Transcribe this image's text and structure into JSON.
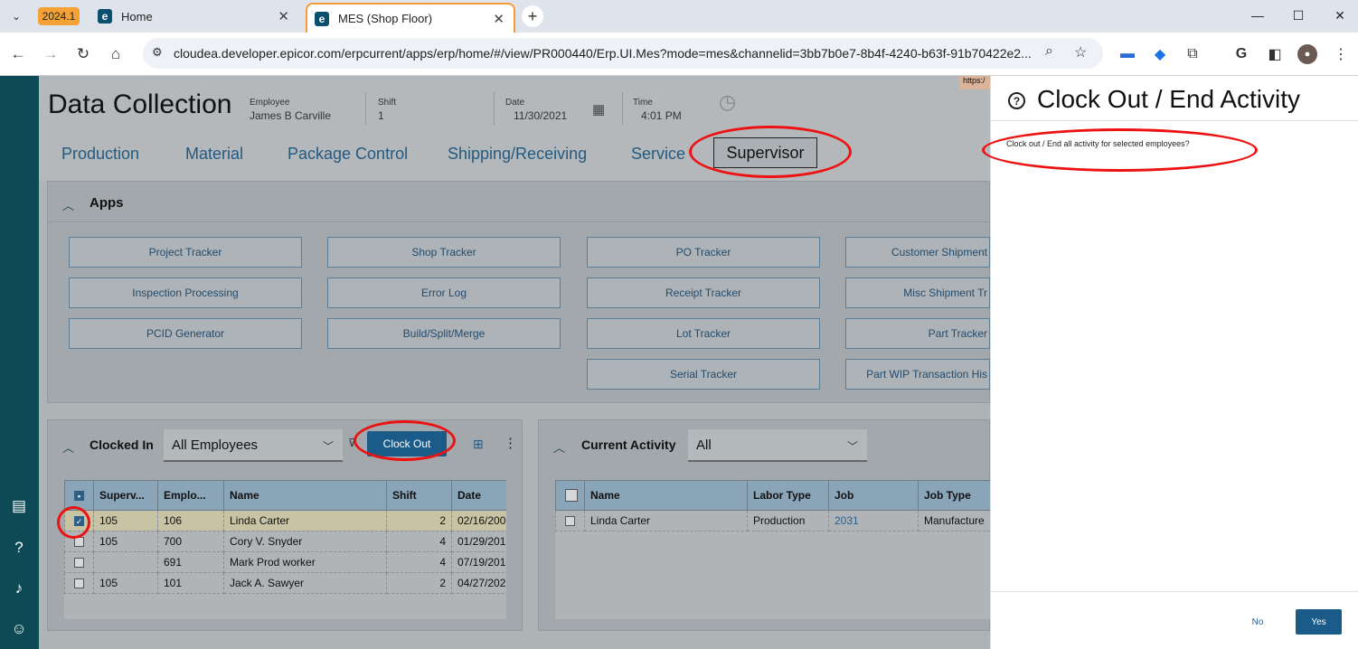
{
  "browser": {
    "version_badge": "2024.1",
    "tabs": [
      {
        "label": "Home",
        "favicon": "e"
      },
      {
        "label": "MES (Shop Floor)",
        "favicon": "e"
      }
    ],
    "url": "cloudea.developer.epicor.com/erpcurrent/apps/erp/home/#/view/PR000440/Erp.UI.Mes?mode=mes&channelid=3bb7b0e7-8b4f-4240-b63f-91b70422e2...",
    "icons": [
      "tab-dropdown-icon",
      "close-icon",
      "new-tab-icon",
      "minimize-icon",
      "maximize-icon",
      "window-close-icon",
      "back-icon",
      "forward-icon",
      "reload-icon",
      "home-icon",
      "site-info-icon",
      "zoom-icon",
      "bookmark-star-icon",
      "extension-icon",
      "google-icon",
      "sidebar-icon",
      "profile-avatar",
      "menu-icon"
    ]
  },
  "header": {
    "title": "Data Collection",
    "employee_label": "Employee",
    "employee_value": "James B Carville",
    "shift_label": "Shift",
    "shift_value": "1",
    "date_label": "Date",
    "date_value": "11/30/2021",
    "time_label": "Time",
    "time_value": "4:01 PM",
    "url_snippet": "https:/"
  },
  "nav_tabs": [
    "Production",
    "Material",
    "Package Control",
    "Shipping/Receiving",
    "Service",
    "Supervisor"
  ],
  "apps_panel": {
    "title": "Apps",
    "buttons": [
      [
        "Project Tracker",
        "Shop Tracker",
        "PO Tracker",
        "Customer Shipment"
      ],
      [
        "Inspection Processing",
        "Error Log",
        "Receipt Tracker",
        "Misc Shipment Tr"
      ],
      [
        "PCID Generator",
        "Build/Split/Merge",
        "Lot Tracker",
        "Part Tracker"
      ],
      [
        "",
        "",
        "Serial Tracker",
        "Part WIP Transaction His"
      ]
    ]
  },
  "clocked_in": {
    "title": "Clocked In",
    "filter": "All Employees",
    "clock_out_label": "Clock Out",
    "columns": [
      "Superv...",
      "Emplo...",
      "Name",
      "Shift",
      "Date"
    ],
    "rows": [
      {
        "checked": true,
        "supervisor": "105",
        "employee": "106",
        "name": "Linda Carter",
        "shift": "2",
        "date": "02/16/200"
      },
      {
        "checked": false,
        "supervisor": "105",
        "employee": "700",
        "name": "Cory V. Snyder",
        "shift": "4",
        "date": "01/29/201"
      },
      {
        "checked": false,
        "supervisor": "",
        "employee": "691",
        "name": "Mark Prod worker",
        "shift": "4",
        "date": "07/19/201"
      },
      {
        "checked": false,
        "supervisor": "105",
        "employee": "101",
        "name": "Jack A. Sawyer",
        "shift": "2",
        "date": "04/27/202"
      }
    ]
  },
  "current_activity": {
    "title": "Current Activity",
    "filter": "All",
    "columns": [
      "Name",
      "Labor Type",
      "Job",
      "Job Type"
    ],
    "rows": [
      {
        "name": "Linda Carter",
        "labor_type": "Production",
        "job": "2031",
        "job_type": "Manufacture"
      }
    ]
  },
  "dialog": {
    "title": "Clock Out / End Activity",
    "message": "Clock out / End all activity for selected employees?",
    "no_label": "No",
    "yes_label": "Yes"
  },
  "colors": {
    "accent": "#1b5b8a",
    "rail": "#0d4a55",
    "annotation_ring": "#e11111",
    "version_badge": "#f4a236"
  }
}
